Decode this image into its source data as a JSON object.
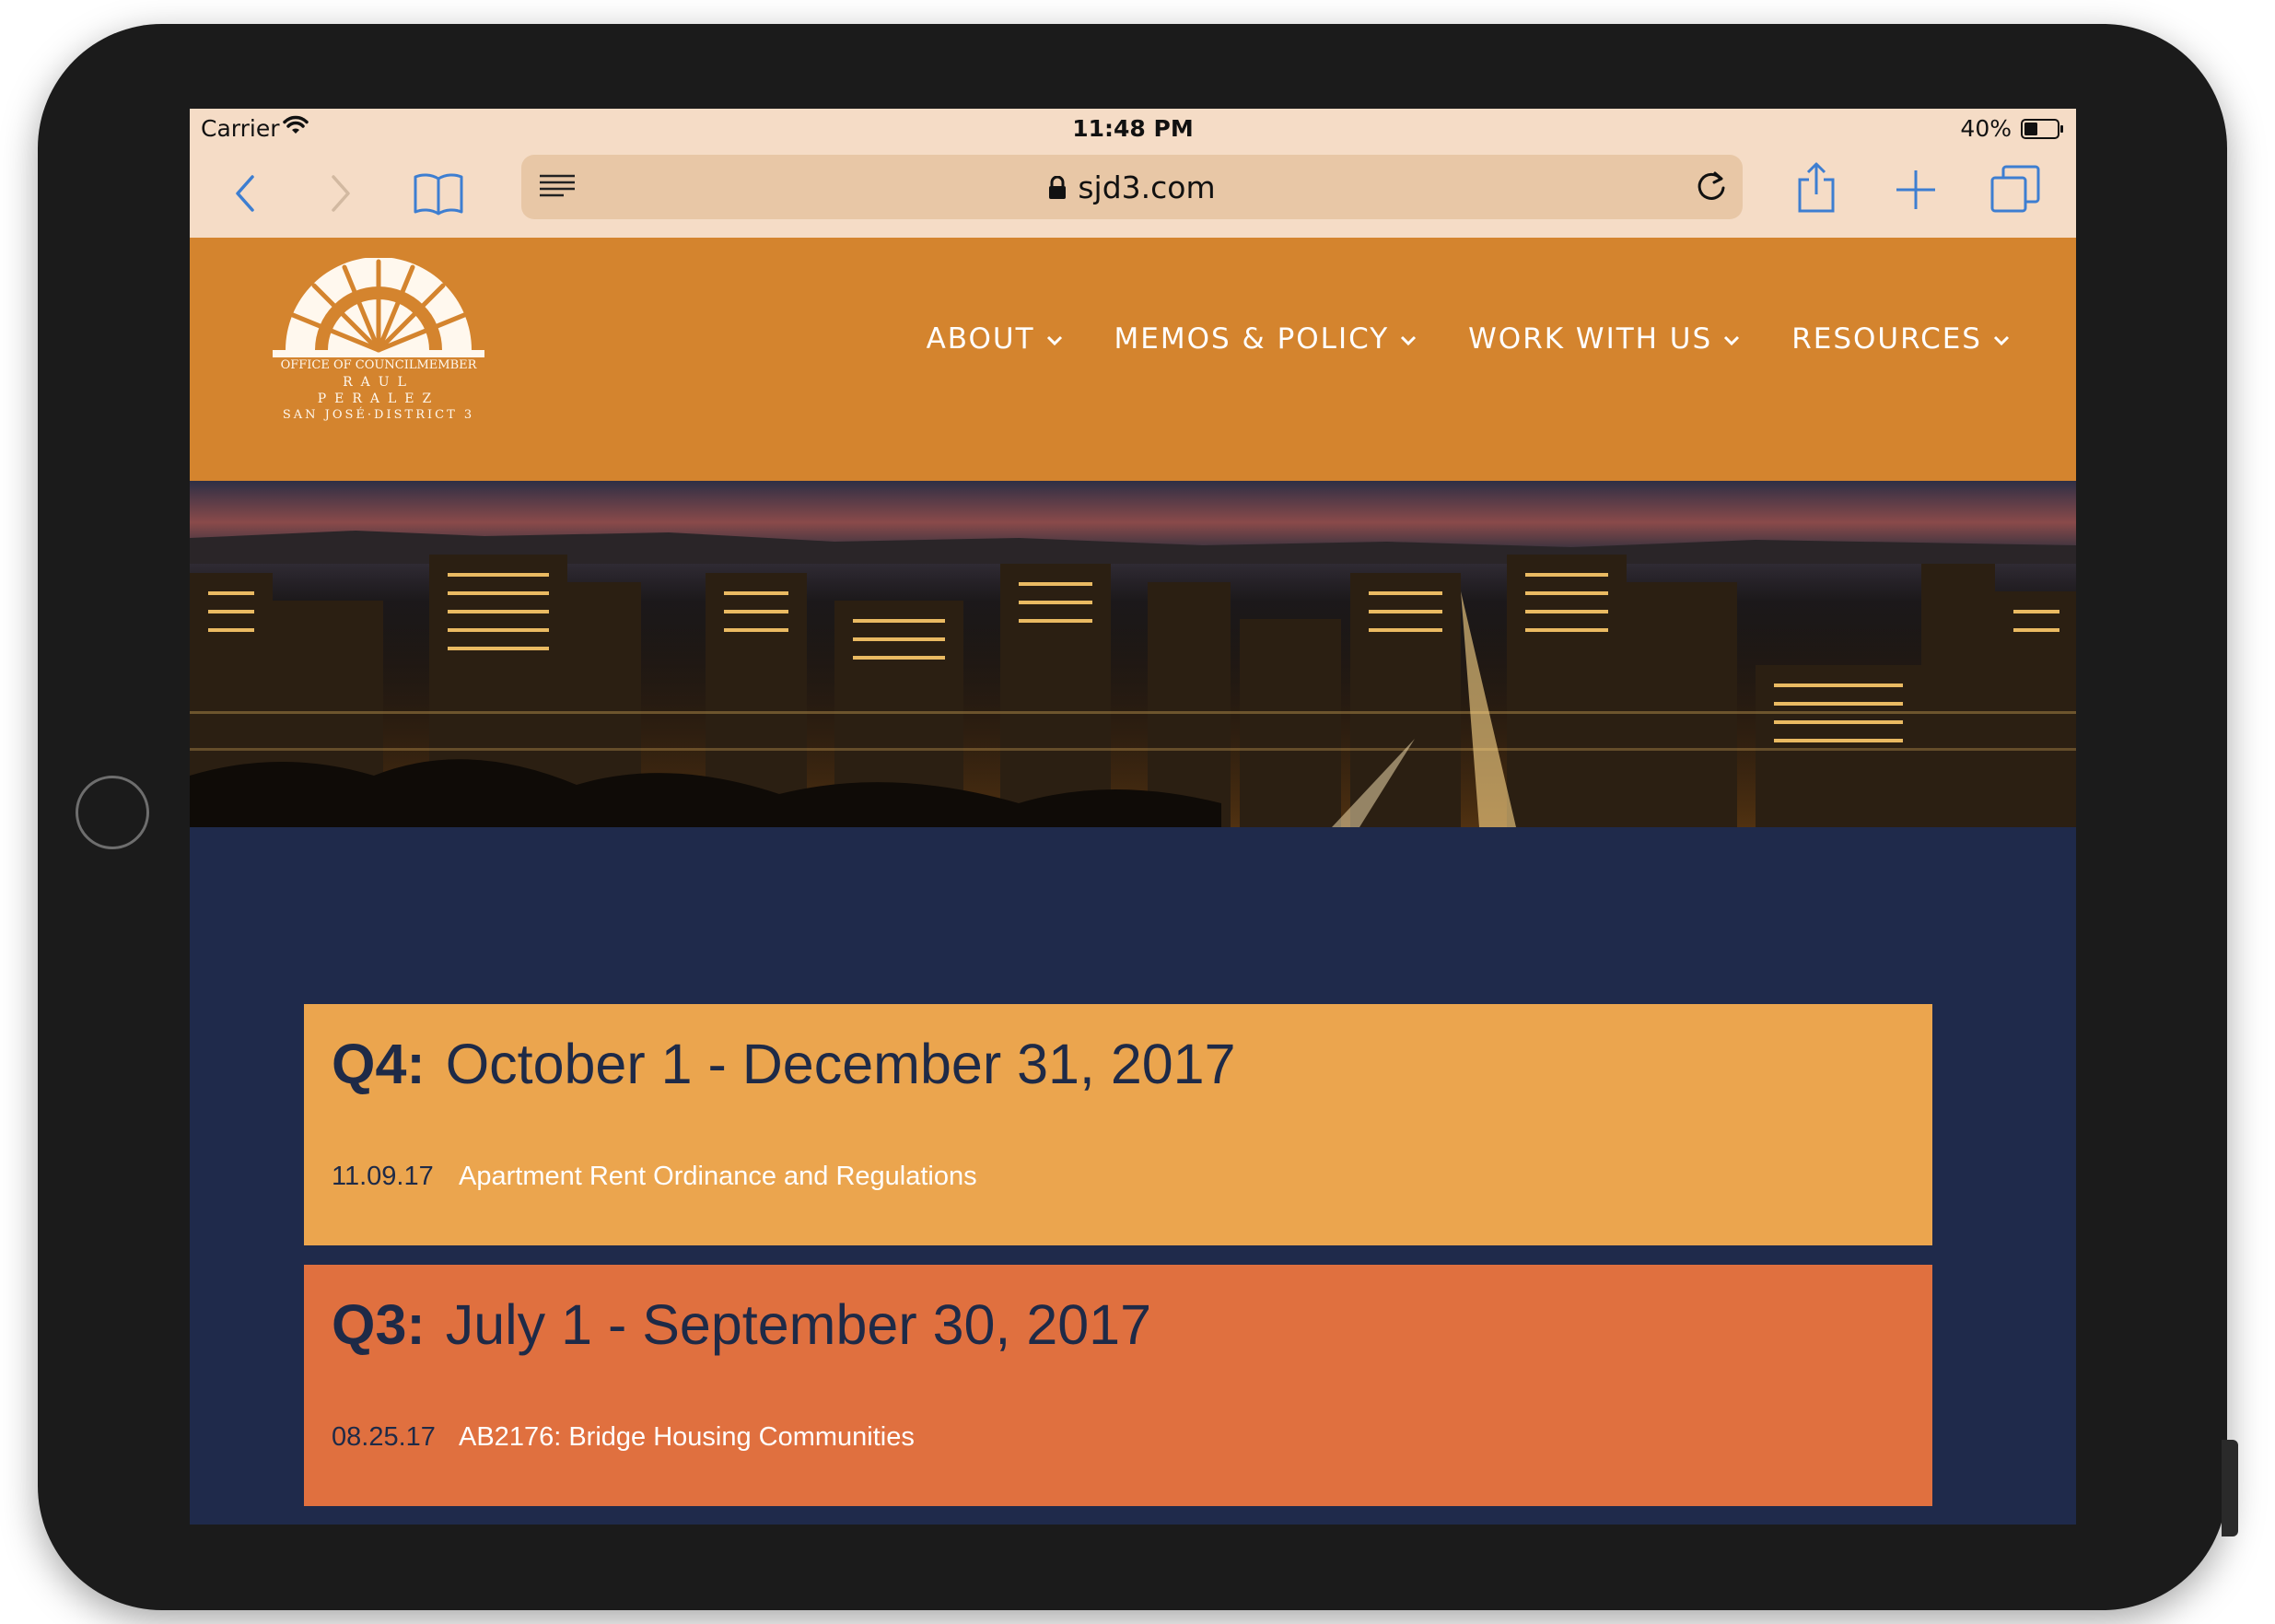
{
  "status_bar": {
    "carrier": "Carrier",
    "time": "11:48 PM",
    "battery": "40%"
  },
  "browser": {
    "url": "sjd3.com"
  },
  "site": {
    "logo_lines": [
      "OFFICE OF COUNCILMEMBER",
      "RAUL PERALEZ",
      "SAN JOSÉ·DISTRICT 3"
    ],
    "nav": [
      {
        "label": "ABOUT"
      },
      {
        "label": "MEMOS & POLICY"
      },
      {
        "label": "WORK WITH US"
      },
      {
        "label": "RESOURCES"
      }
    ]
  },
  "quarters": [
    {
      "label": "Q4:",
      "range": "October 1 - December 31, 2017",
      "entries": [
        {
          "date": "11.09.17",
          "title": "Apartment Rent Ordinance and Regulations"
        }
      ]
    },
    {
      "label": "Q3:",
      "range": "July 1 - September 30, 2017",
      "entries": [
        {
          "date": "08.25.17",
          "title": "AB2176: Bridge Housing Communities"
        }
      ]
    }
  ],
  "colors": {
    "header_orange": "#d4842e",
    "page_navy": "#1f2a4b",
    "q4_card": "#eba54e",
    "q3_card": "#e0703f",
    "safari_bar": "#f5dcc6",
    "link_blue": "#3d7ed1"
  },
  "icons": [
    "wifi-icon",
    "battery-icon",
    "back-icon",
    "forward-icon",
    "bookmarks-icon",
    "reader-icon",
    "lock-icon",
    "reload-icon",
    "share-icon",
    "new-tab-icon",
    "tabs-icon",
    "chevron-down-icon",
    "sun-logo"
  ]
}
